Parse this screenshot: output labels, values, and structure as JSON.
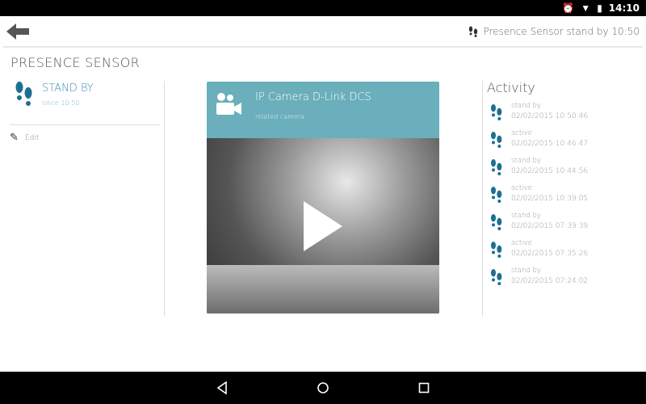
{
  "status_bar": {
    "time": "14:10"
  },
  "header": {
    "status_text": "Presence Sensor stand by 10:50"
  },
  "page_title": "PRESENCE SENSOR",
  "sensor": {
    "state": "STAND BY",
    "since": "since 10:50",
    "edit_label": "Edit"
  },
  "camera": {
    "title": "IP Camera D-Link DCS",
    "subtitle": "related camera"
  },
  "activity": {
    "title": "Activity",
    "items": [
      {
        "state": "stand by",
        "time": "02/02/2015 10:50:46"
      },
      {
        "state": "active",
        "time": "02/02/2015 10:46:47"
      },
      {
        "state": "stand by",
        "time": "02/02/2015 10:44:56"
      },
      {
        "state": "active",
        "time": "02/02/2015 10:39:05"
      },
      {
        "state": "stand by",
        "time": "02/02/2015 07:39:39"
      },
      {
        "state": "active",
        "time": "02/02/2015 07:35:26"
      },
      {
        "state": "stand by",
        "time": "02/02/2015 07:24:02"
      }
    ]
  },
  "colors": {
    "accent": "#1d6e93",
    "card": "#6aafbb"
  }
}
